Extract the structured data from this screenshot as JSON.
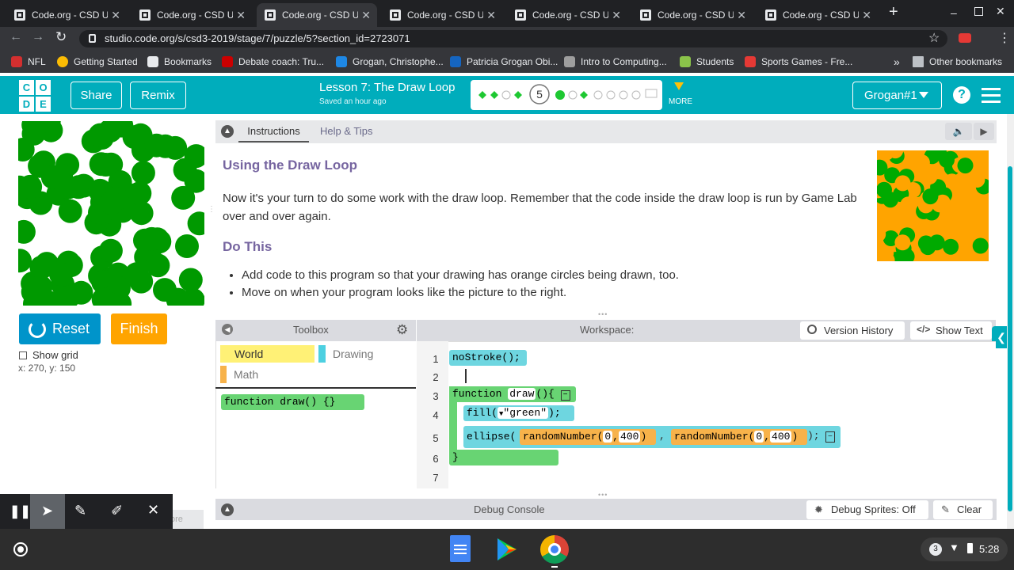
{
  "browser": {
    "tabs": [
      {
        "title": "Code.org - CSD Uni",
        "active": false
      },
      {
        "title": "Code.org - CSD Uni",
        "active": false
      },
      {
        "title": "Code.org - CSD Uni",
        "active": true
      },
      {
        "title": "Code.org - CSD Uni",
        "active": false
      },
      {
        "title": "Code.org - CSD Uni",
        "active": false
      },
      {
        "title": "Code.org - CSD Uni",
        "active": false
      },
      {
        "title": "Code.org - CSD Uni",
        "active": false
      }
    ],
    "url": "studio.code.org/s/csd3-2019/stage/7/puzzle/5?section_id=2723071",
    "bookmarks": [
      {
        "label": "NFL",
        "color": "#d32f2f"
      },
      {
        "label": "Getting Started",
        "color": "#fbbc04"
      },
      {
        "label": "Bookmarks",
        "color": "#e8eaed"
      },
      {
        "label": "Debate coach: Tru...",
        "color": "#cc0000"
      },
      {
        "label": "Grogan, Christophe...",
        "color": "#1e88e5"
      },
      {
        "label": "Patricia Grogan Obi...",
        "color": "#1565c0"
      },
      {
        "label": "Intro to Computing...",
        "color": "#9e9e9e"
      },
      {
        "label": "Students",
        "color": "#8bc34a"
      },
      {
        "label": "Sports Games - Fre...",
        "color": "#e53935"
      }
    ],
    "other_bookmarks": "Other bookmarks"
  },
  "header": {
    "share": "Share",
    "remix": "Remix",
    "lesson_title": "Lesson 7: The Draw Loop",
    "saved": "Saved an hour ago",
    "current_level": "5",
    "more": "MORE",
    "user": "Grogan#1"
  },
  "left": {
    "reset": "Reset",
    "finish": "Finish",
    "show_grid": "Show grid",
    "coords": "x: 270, y: 150"
  },
  "instructions": {
    "tab_instructions": "Instructions",
    "tab_help": "Help & Tips",
    "heading": "Using the Draw Loop",
    "body": "Now it's your turn to do some work with the draw loop. Remember that the code inside the draw loop is run by Game Lab over and over again.",
    "do_this": "Do This",
    "bullets": [
      "Add code to this program so that your drawing has orange circles being drawn, too.",
      "Move on when your program looks like the picture to the right."
    ]
  },
  "toolbox": {
    "title": "Toolbox",
    "categories": [
      {
        "label": "World",
        "color": "#fff176"
      },
      {
        "label": "Drawing",
        "color": "#4dd0e1"
      },
      {
        "label": "Math",
        "color": "#f7b24a"
      }
    ],
    "block": "function draw() {}"
  },
  "workspace": {
    "title": "Workspace:",
    "version_history": "Version History",
    "show_text": "Show Text",
    "line_numbers": [
      "1",
      "2",
      "3",
      "4",
      "5",
      "6",
      "7"
    ],
    "code": {
      "nostroke": "noStroke();",
      "function_kw": "function",
      "draw_name": "draw",
      "draw_tail": "(){",
      "fill_name": "fill(",
      "fill_arg": "\"green\"",
      "fill_tail": ");",
      "ellipse_name": "ellipse(",
      "random_name": "randomNumber(",
      "rn_min": "0",
      "rn_max": "400",
      "close": "}"
    }
  },
  "debug": {
    "title": "Debug Console",
    "sprites": "Debug Sprites: Off",
    "clear": "Clear"
  },
  "shelf": {
    "time": "5:28",
    "badge": "3",
    "under_text": "ore"
  }
}
